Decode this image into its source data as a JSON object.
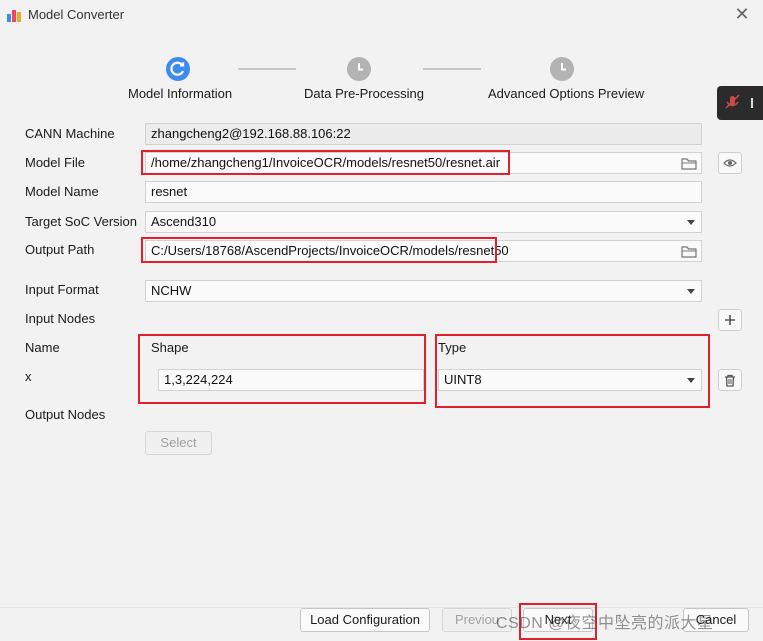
{
  "window": {
    "title": "Model Converter",
    "close_icon": "close-icon"
  },
  "colors": {
    "accent": "#3c8cf0",
    "highlight": "#e0202c",
    "inactive": "#b3b3b3"
  },
  "steps": [
    {
      "label": "Model Information",
      "state": "active"
    },
    {
      "label": "Data Pre-Processing",
      "state": "pending"
    },
    {
      "label": "Advanced Options  Preview",
      "state": "pending"
    }
  ],
  "form": {
    "cann_machine": {
      "label": "CANN Machine",
      "value": "zhangcheng2@192.168.88.106:22"
    },
    "model_file": {
      "label": "Model File",
      "value": "/home/zhangcheng1/InvoiceOCR/models/resnet50/resnet.air"
    },
    "model_name": {
      "label": "Model Name",
      "value": "resnet"
    },
    "target_soc": {
      "label": "Target SoC Version",
      "value": "Ascend310"
    },
    "output_path": {
      "label": "Output Path",
      "value": "C:/Users/18768/AscendProjects/InvoiceOCR/models/resnet50"
    },
    "input_format": {
      "label": "Input Format",
      "value": "NCHW"
    },
    "input_nodes": {
      "label": "Input Nodes"
    },
    "node_table": {
      "name_header": "Name",
      "shape_header": "Shape",
      "type_header": "Type",
      "rows": [
        {
          "name": "x",
          "shape": "1,3,224,224",
          "type": "UINT8"
        }
      ]
    },
    "output_nodes": {
      "label": "Output Nodes",
      "select_button": "Select"
    }
  },
  "footer": {
    "load_config": "Load Configuration",
    "previous": "Previou",
    "next": "Next",
    "cancel": "Cancel"
  },
  "watermark": "CSDN @夜空中坠亮的派大星"
}
